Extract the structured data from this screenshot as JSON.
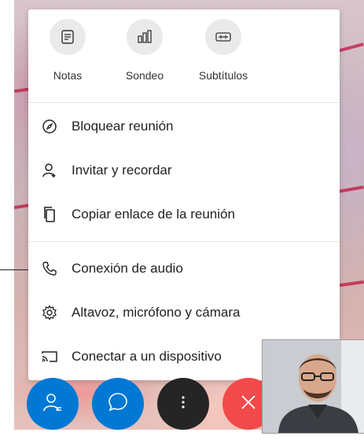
{
  "menu": {
    "quick_actions": [
      {
        "label": "Notas",
        "icon": "notes-icon"
      },
      {
        "label": "Sondeo",
        "icon": "poll-icon"
      },
      {
        "label": "Subtítulos",
        "icon": "captions-icon"
      }
    ],
    "items": [
      {
        "label": "Bloquear reunión",
        "icon": "lock-meeting-icon"
      },
      {
        "label": "Invitar y recordar",
        "icon": "invite-person-icon"
      },
      {
        "label": "Copiar enlace de la reunión",
        "icon": "copy-link-icon"
      },
      {
        "label": "Conexión de audio",
        "icon": "phone-icon"
      },
      {
        "label": "Altavoz, micrófono y cámara",
        "icon": "gear-icon"
      },
      {
        "label": "Conectar a un dispositivo",
        "icon": "cast-icon"
      }
    ]
  },
  "controls": {
    "participants_color": "#0078d4",
    "chat_color": "#0078d4",
    "more_color": "#252525",
    "hangup_color": "#f24a4a"
  }
}
